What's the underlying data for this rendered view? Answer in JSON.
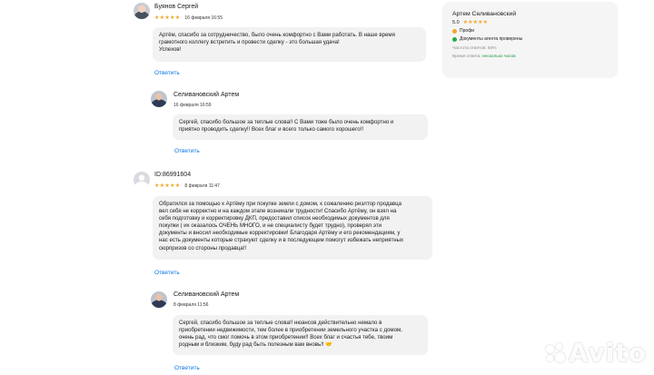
{
  "reviews": [
    {
      "author": "Буянов Сергей",
      "stars": "★★★★★",
      "date": "16 февраля 16:55",
      "text_lines": [
        "Артём, спасибо за сотрудничество, было очень комфортно с Вами работать. В наше время",
        "грамотного коллегу встретить и провести сделку - это большая удача!",
        "Успехов!"
      ],
      "reply_label": "Ответить",
      "answer": {
        "author": "Селивановский Артем",
        "date": "16 февраля 16:59",
        "text_lines": [
          "Сергей, спасибо большое за теплые слова!! С Вами тоже было очень комфортно и",
          "приятно проводить сделку!! Всех благ и всего только самого хорошего!!"
        ],
        "reply_label": "Ответить"
      }
    },
    {
      "author": "ID:86991604",
      "stars": "★★★★★",
      "date": "8 февраля 11:47",
      "text_lines": [
        "Обратился за помощью к Артёму при покупке земли с домом, к сожалению риэлтор продавца",
        "вел себя не корректно и на каждом этапе возникали трудности! Спасибо Артёму, он взял на",
        "себя подготовку и корректировку ДКП, предоставил список необходимых документов для",
        "покупки ( их оказалось ОЧЕНЬ МНОГО, и не специалисту будет трудно), проверял эти",
        "документы и вносил необходимые корректировки! Благодаря Артёму и его рекомендациям, у",
        "нас есть документы которые страхуют сделку и в последующем помогут избежать неприятных",
        "сюрпризов со стороны продавца!!"
      ],
      "reply_label": "Ответить",
      "answer": {
        "author": "Селивановский Артем",
        "date": "8 февраля 11:56",
        "text_lines": [
          "Сергей, спасибо большое за теплые слова!! нюансов действительно немало в",
          "приобретении недвижимости, тем более в приобретении земельного участка с домом,",
          "очень рад, что смог помочь в этом приобретении!! Всех благ и счастья тебе, твоим",
          "родным и близким, буду рад быть полезным вам вновь!! 🤝"
        ],
        "reply_label": "Ответить"
      }
    }
  ],
  "seller_card": {
    "name": "Артем Селивановский",
    "rating": "5.0",
    "stars": "★★★★★",
    "badge_pro": "Профи",
    "badge_docs": "Документы агента проверены",
    "answered_label": "Частота ответов: 50%",
    "response_time_label": "Время ответа:",
    "response_time_value": "несколько часов",
    "colors": {
      "pro": "#f5a623",
      "docs": "#2aa84a"
    }
  },
  "watermark": {
    "text": "Avito"
  }
}
